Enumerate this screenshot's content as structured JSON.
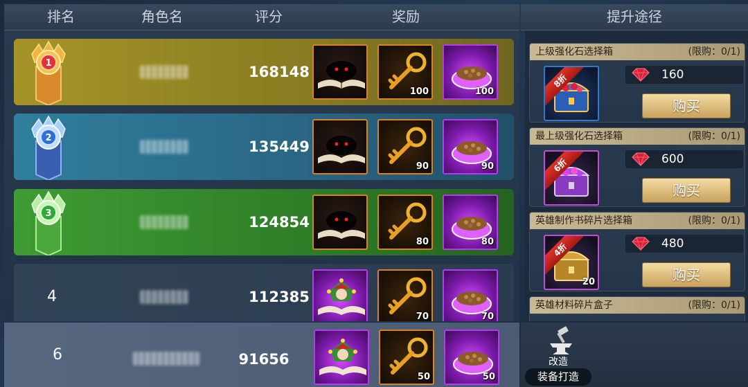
{
  "ranking": {
    "headers": {
      "rank": "排名",
      "name": "角色名",
      "score": "评分",
      "reward": "奖励"
    },
    "rows": [
      {
        "rank": "1",
        "score": "168148",
        "rewards": [
          {
            "icon": "dark-book-icon"
          },
          {
            "icon": "golden-key-icon",
            "qty": "100"
          },
          {
            "icon": "food-bowl-icon",
            "qty": "100"
          }
        ]
      },
      {
        "rank": "2",
        "score": "135449",
        "rewards": [
          {
            "icon": "dark-book-icon"
          },
          {
            "icon": "golden-key-icon",
            "qty": "90"
          },
          {
            "icon": "food-bowl-icon",
            "qty": "90"
          }
        ]
      },
      {
        "rank": "3",
        "score": "124854",
        "rewards": [
          {
            "icon": "dark-book-icon"
          },
          {
            "icon": "golden-key-icon",
            "qty": "80"
          },
          {
            "icon": "food-bowl-icon",
            "qty": "80"
          }
        ]
      },
      {
        "rank": "4",
        "score": "112385",
        "rewards": [
          {
            "icon": "jester-book-icon"
          },
          {
            "icon": "golden-key-icon",
            "qty": "70"
          },
          {
            "icon": "food-bowl-icon",
            "qty": "70"
          }
        ]
      }
    ],
    "self_row": {
      "rank": "6",
      "score": "91656",
      "rewards": [
        {
          "icon": "jester-book-icon"
        },
        {
          "icon": "golden-key-icon",
          "qty": "50"
        },
        {
          "icon": "food-bowl-icon",
          "qty": "50"
        }
      ]
    }
  },
  "shop": {
    "title": "提升途径",
    "items": [
      {
        "name": "上级强化石选择箱",
        "limit": "(限购：0/1)",
        "discount": "8折",
        "price": "160",
        "buy": "购买",
        "icon": "blue-chest-icon"
      },
      {
        "name": "最上级强化石选择箱",
        "limit": "(限购：0/1)",
        "discount": "6折",
        "price": "600",
        "buy": "购买",
        "icon": "purple-chest-icon"
      },
      {
        "name": "英雄制作书碎片选择箱",
        "limit": "(限购：0/1)",
        "discount": "4折",
        "price": "480",
        "buy": "购买",
        "icon": "gold-chest-icon",
        "count": "20"
      },
      {
        "name": "英雄材料碎片盒子",
        "limit": "(限购：0/1)"
      }
    ],
    "forge": {
      "label": "改造",
      "button": "装备打造",
      "icon": "anvil-hammer-icon"
    }
  },
  "colors": {
    "gold_row": "#a59428",
    "blue_row": "#2f7f9d",
    "green_row": "#3f9b33",
    "gem": "#d8203a"
  }
}
